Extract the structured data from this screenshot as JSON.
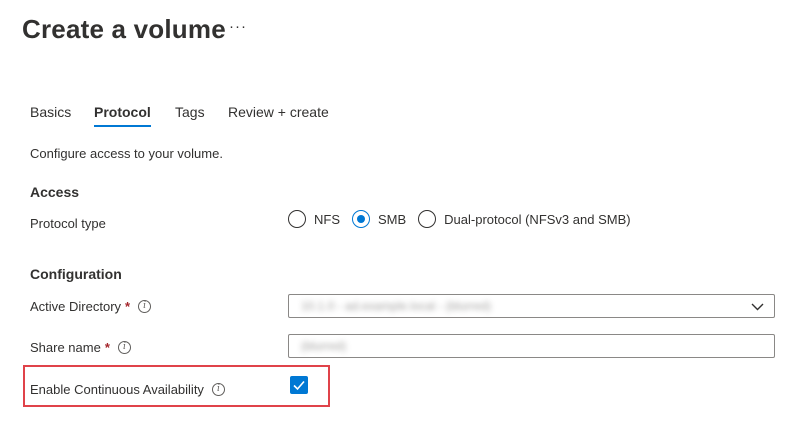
{
  "page": {
    "title": "Create a volume",
    "more_label": "···"
  },
  "tabs": [
    {
      "label": "Basics",
      "active": false
    },
    {
      "label": "Protocol",
      "active": true
    },
    {
      "label": "Tags",
      "active": false
    },
    {
      "label": "Review + create",
      "active": false
    }
  ],
  "description": "Configure access to your volume.",
  "access": {
    "heading": "Access",
    "protocol_label": "Protocol type",
    "options": [
      {
        "label": "NFS",
        "checked": false
      },
      {
        "label": "SMB",
        "checked": true
      },
      {
        "label": "Dual-protocol (NFSv3 and SMB)",
        "checked": false
      }
    ]
  },
  "configuration": {
    "heading": "Configuration",
    "active_directory": {
      "label": "Active Directory",
      "required": "*",
      "value": "10.1.0 - ad.example.local - (blurred)"
    },
    "share_name": {
      "label": "Share name",
      "required": "*",
      "value": "(blurred)"
    },
    "continuous_availability": {
      "label": "Enable Continuous Availability",
      "checked": true
    }
  },
  "colors": {
    "accent": "#0078d4",
    "required": "#a4262c",
    "highlight": "#e0434a"
  }
}
